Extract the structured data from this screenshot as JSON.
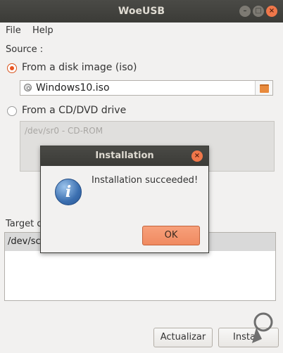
{
  "window": {
    "title": "WoeUSB"
  },
  "window_controls": {
    "minimize": "–",
    "maximize": "□",
    "close": "×"
  },
  "menu": {
    "file": "File",
    "help": "Help"
  },
  "source": {
    "label": "Source :",
    "disk_image_option": "From a disk image (iso)",
    "disk_image_value": "Windows10.iso",
    "dvd_option": "From a CD/DVD drive",
    "dvd_item": "/dev/sr0 - CD-ROM"
  },
  "target": {
    "label": "Target d",
    "device": "/dev/sc"
  },
  "buttons": {
    "refresh": "Actualizar",
    "install": "Instal"
  },
  "dialog": {
    "title": "Installation",
    "close": "×",
    "message": "Installation succeeded!",
    "info_glyph": "i",
    "ok": "OK"
  },
  "colors": {
    "titlebar": "#3c3b37",
    "accent": "#e95420",
    "ok_button": "#f08a60",
    "info_icon": "#3b6fb0"
  },
  "icons": [
    "disc-icon",
    "folder-icon",
    "info-icon",
    "close-icon",
    "minimize-icon",
    "maximize-icon"
  ]
}
